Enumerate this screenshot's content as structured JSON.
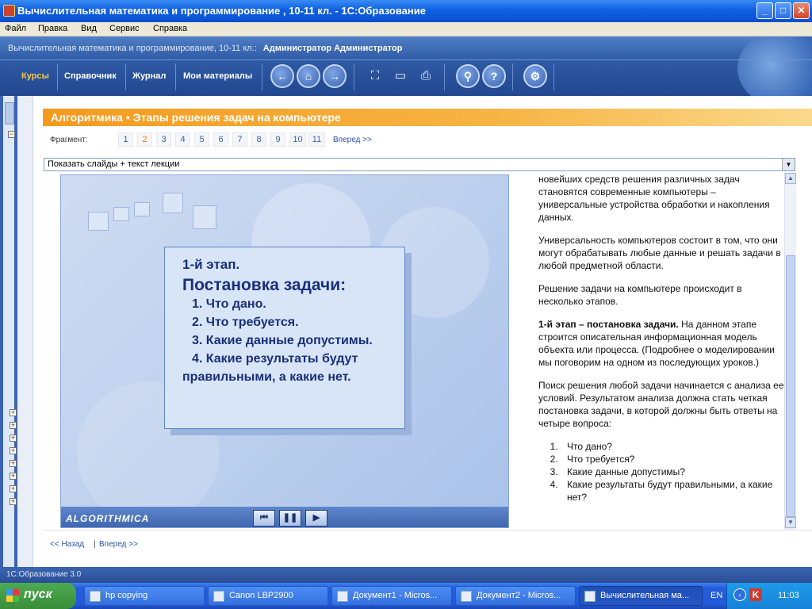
{
  "window": {
    "title": "Вычислительная математика и программирование , 10-11 кл. - 1С:Образование",
    "controls": {
      "minimize": "_",
      "maximize": "□",
      "close": "✕"
    }
  },
  "menu": [
    "Файл",
    "Правка",
    "Вид",
    "Сервис",
    "Справка"
  ],
  "header": {
    "course": "Вычислительная математика и программирование, 10-11 кл.:",
    "user": "Администратор Администратор",
    "nav": [
      "Курсы",
      "Справочник",
      "Журнал",
      "Мои материалы"
    ],
    "active_nav": "Курсы",
    "toolbar_icons": [
      "back-arrow-icon",
      "home-icon",
      "forward-arrow-icon",
      "fullscreen-icon",
      "presentation-icon",
      "print-icon",
      "search-icon",
      "help-icon",
      "settings-icon"
    ]
  },
  "lesson": {
    "title": "Алгоритмика • Этапы решения задач на компьютере",
    "fragment_label": "Фрагмент:",
    "fragments": [
      "1",
      "2",
      "3",
      "4",
      "5",
      "6",
      "7",
      "8",
      "9",
      "10",
      "11"
    ],
    "current_fragment": "2",
    "forward_link": "Вперед >>",
    "view_mode": "Показать слайды + текст лекции"
  },
  "slide": {
    "stage": "1-й этап.",
    "heading": "Постановка задачи:",
    "items": [
      "1. Что дано.",
      "2. Что требуется.",
      "3. Какие данные допустимы.",
      "4. Какие результаты будут правильными, а какие нет."
    ],
    "brand": "ALGORITHMICA",
    "controls": {
      "first": "⏮",
      "pause": "❚❚",
      "next": "▶"
    }
  },
  "lecture": {
    "p1": "новейших средств решения различных задач становятся современные компьютеры – универсальные устройства обработки и накопления данных.",
    "p2": "Универсальность компьютеров состоит в том, что они могут обрабатывать любые данные и решать задачи в любой предметной области.",
    "p3": "Решение задачи на компьютере происходит в несколько этапов.",
    "p4_bold": "1-й этап – постановка задачи.",
    "p4_rest": " На данном этапе строится описательная информационная модель объекта или процесса. (Подробнее о моделировании мы поговорим на одном из последующих уроков.)",
    "p5": "Поиск решения любой задачи начинается с анализа ее условий. Результатом анализа должна стать четкая постановка задачи, в которой должны быть ответы на четыре вопроса:",
    "questions": [
      "Что дано?",
      "Что требуется?",
      "Какие данные допустимы?",
      "Какие результаты будут правильными, а какие нет?"
    ]
  },
  "bottom_nav": {
    "back": "<< Назад",
    "sep": "|",
    "forward": "Вперед >>"
  },
  "status": "1С:Образование 3.0",
  "taskbar": {
    "start": "пуск",
    "tasks": [
      {
        "label": "hp copying",
        "active": false
      },
      {
        "label": "Canon LBP2900",
        "active": false
      },
      {
        "label": "Документ1 - Micros...",
        "active": false
      },
      {
        "label": "Документ2 - Micros...",
        "active": false
      },
      {
        "label": "Вычислительная ма...",
        "active": true
      }
    ],
    "lang": "EN",
    "clock": "11:03"
  }
}
